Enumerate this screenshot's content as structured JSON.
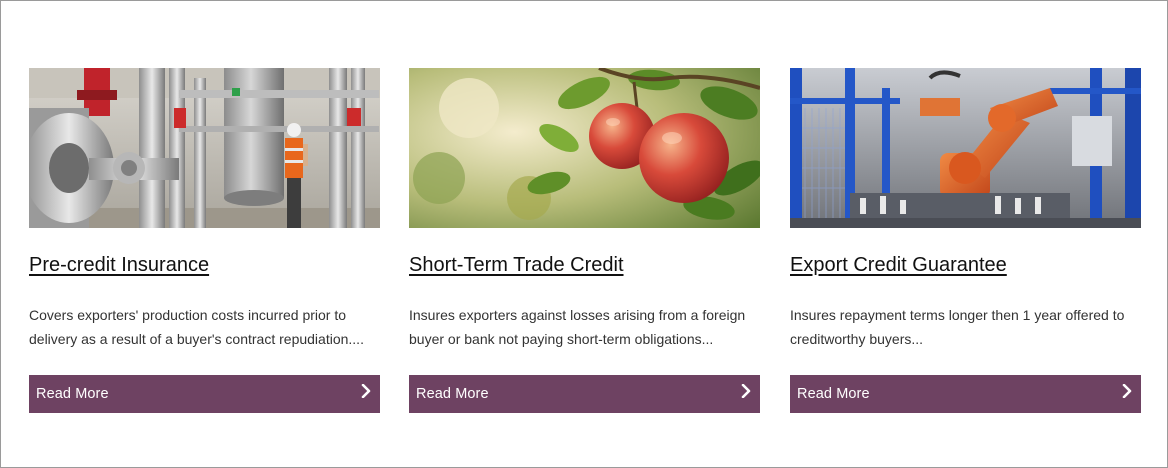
{
  "cards": [
    {
      "title": "Pre-credit Insurance",
      "description": "Covers exporters' production costs incurred prior to delivery as a result of a buyer's contract repudiation....",
      "button_label": "Read More",
      "image_subject": "industrial plant engineer with hard hat",
      "button_icon": "chevron-right-icon"
    },
    {
      "title": "Short-Term Trade Credit",
      "description": "Insures exporters against losses arising from a foreign buyer or bank not paying short-term obligations...",
      "button_label": "Read More",
      "image_subject": "red apples hanging on tree branch",
      "button_icon": "chevron-right-icon"
    },
    {
      "title": "Export Credit Guarantee",
      "description": "Insures repayment terms longer then 1 year offered to creditworthy buyers...",
      "button_label": "Read More",
      "image_subject": "orange industrial robot arm in factory",
      "button_icon": "chevron-right-icon"
    }
  ],
  "colors": {
    "button_background": "#6e4262",
    "button_text": "#ffffff",
    "title_text": "#111111",
    "body_text": "#333333"
  }
}
